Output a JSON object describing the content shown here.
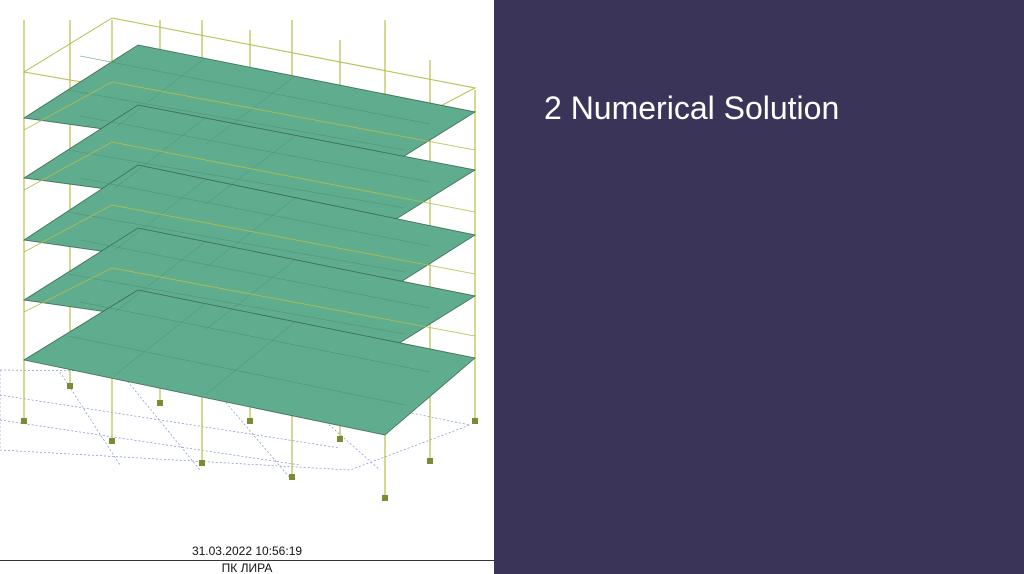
{
  "model_view": {
    "timestamp": "31.03.2022 10:56:19",
    "program_name": "ПК ЛИРА",
    "colors": {
      "slab_fill": "#5fac8f",
      "frame_line": "#b7bd4a",
      "support_line": "#7a8b34",
      "grid_line": "#6e7fd0"
    }
  },
  "slide": {
    "title": "2 Numerical Solution",
    "background_color": "#3b3459",
    "title_color": "#ffffff"
  }
}
